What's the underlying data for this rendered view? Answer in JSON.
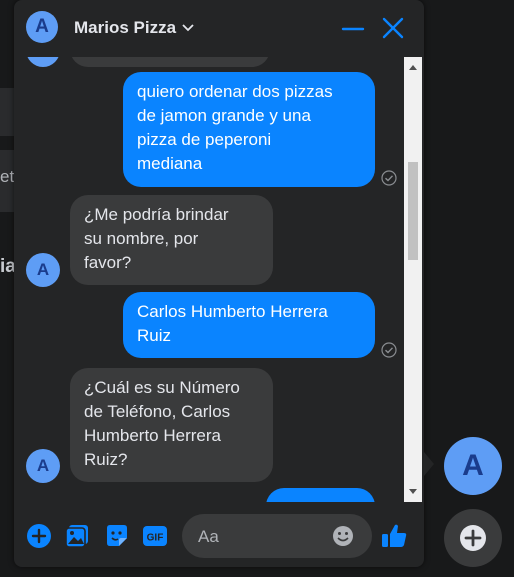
{
  "background": {
    "fragment_1": "et",
    "fragment_2": "ia"
  },
  "chat": {
    "contact_initial": "A",
    "title": "Marios Pizza",
    "messages": [
      {
        "direction": "out",
        "lines": [
          "quiero ordenar dos pizzas",
          "de jamon grande y una",
          "pizza de peperoni",
          "mediana"
        ]
      },
      {
        "direction": "in",
        "lines": [
          "¿Me podría brindar",
          "su nombre, por",
          "favor?"
        ]
      },
      {
        "direction": "out",
        "lines": [
          "Carlos Humberto Herrera",
          "Ruiz"
        ]
      },
      {
        "direction": "in",
        "lines": [
          "¿Cuál es su Número",
          "de Teléfono, Carlos",
          "Humberto Herrera",
          "Ruiz?"
        ]
      }
    ],
    "composer": {
      "placeholder": "Aa",
      "gif_label": "GIF"
    }
  },
  "chat_heads": {
    "active_initial": "A"
  },
  "colors": {
    "accent": "#0a84ff",
    "avatar": "#5e9df5",
    "panel": "#242526",
    "incoming_bubble": "#3a3b3c"
  }
}
